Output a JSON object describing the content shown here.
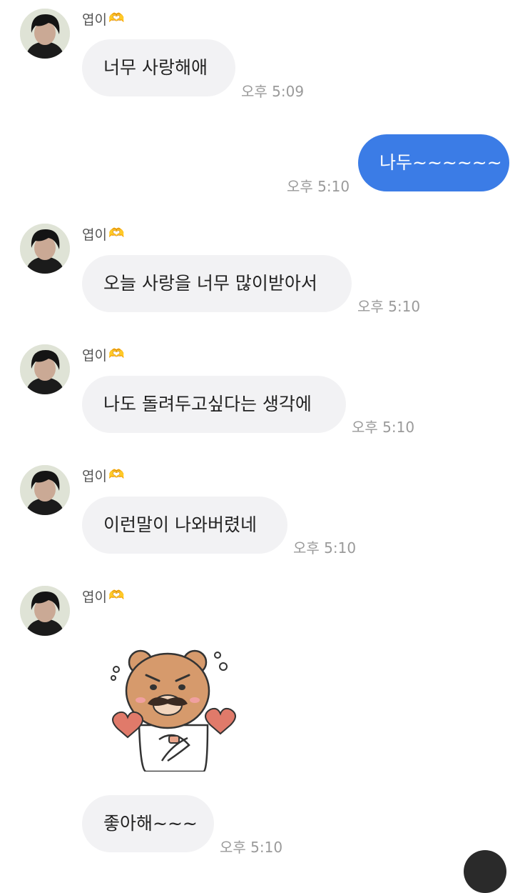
{
  "chat": {
    "sender_name": "엽이",
    "messages": [
      {
        "text": "너무 사랑해애",
        "time": "오후 5:09"
      },
      {
        "text": "나두~~~~~~",
        "time": "오후 5:10"
      },
      {
        "text": "오늘 사랑을 너무 많이받아서",
        "time": "오후 5:10"
      },
      {
        "text": "나도 돌려두고싶다는 생각에",
        "time": "오후 5:10"
      },
      {
        "text": "이런말이 나와버렸네",
        "time": "오후 5:10"
      },
      {
        "text": "좋아해~~~",
        "time": "오후 5:10"
      }
    ],
    "sticker": {
      "icon": "bear-mustache-hearts-sticker"
    }
  },
  "colors": {
    "outgoing_bubble": "#3b7ce6",
    "incoming_bubble": "#f2f2f4",
    "timestamp": "#9a9a9a"
  }
}
